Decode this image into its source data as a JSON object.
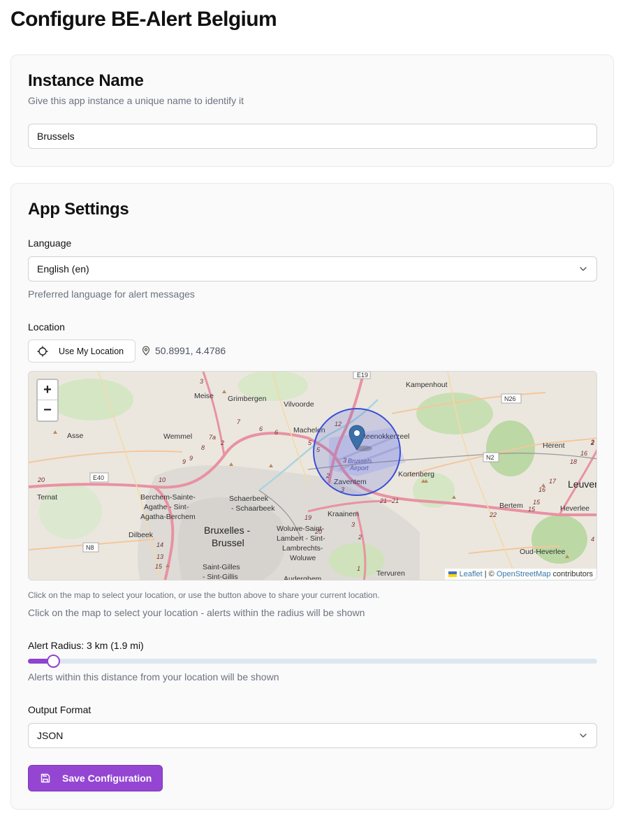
{
  "page": {
    "title": "Configure BE-Alert Belgium"
  },
  "instance": {
    "title": "Instance Name",
    "description": "Give this app instance a unique name to identify it",
    "value": "Brussels"
  },
  "settings": {
    "title": "App Settings",
    "language": {
      "label": "Language",
      "selected": "English (en)",
      "help": "Preferred language for alert messages"
    },
    "location": {
      "label": "Location",
      "use_my_location": "Use My Location",
      "coordinates": "50.8991, 4.4786",
      "help_small": "Click on the map to select your location, or use the button above to share your current location.",
      "help": "Click on the map to select your location - alerts within the radius will be shown"
    },
    "map": {
      "zoom_in": "+",
      "zoom_out": "−",
      "attribution": {
        "leaflet": "Leaflet",
        "sep": " | © ",
        "osm": "OpenStreetMap",
        "contributors": " contributors"
      },
      "places": {
        "kampenhout": "Kampenhout",
        "meise": "Meise",
        "grimbergen": "Grimbergen",
        "vilvoorde": "Vilvoorde",
        "asse": "Asse",
        "wemmel": "Wemmel",
        "machelen": "Machelen",
        "steenokkerzeel": "Steenokkerzeel",
        "herent": "Herent",
        "brussels_airport_1": "Brussels",
        "brussels_airport_2": "Airport",
        "leuven": "Leuven",
        "kortenberg": "Kortenberg",
        "zaventem": "Zaventem",
        "ternat": "Ternat",
        "berchem_1": "Berchem-Sainte-",
        "berchem_2": "Agathe - Sint-",
        "berchem_3": "Agatha-Berchem",
        "schaerbeek_1": "Schaerbeek",
        "schaerbeek_2": "- Schaarbeek",
        "kraainem": "Kraainem",
        "bertem": "Bertem",
        "heverlee": "Heverlee",
        "dilbeek": "Dilbeek",
        "bruxelles_1": "Bruxelles -",
        "bruxelles_2": "Brussel",
        "woluwe_1": "Woluwe-Saint-",
        "woluwe_2": "Lambert - Sint-",
        "woluwe_3": "Lambrechts-",
        "woluwe_4": "Woluwe",
        "oud_heverlee": "Oud-Heverlee",
        "stgilles_1": "Saint-Gilles",
        "stgilles_2": "- Sint-Gillis",
        "auderghem": "Auderghem",
        "tervuren": "Tervuren"
      },
      "roads": {
        "e19": "E19",
        "n26": "N26",
        "n2": "N2",
        "e40": "E40",
        "n8": "N8"
      },
      "road_numbers": [
        "3",
        "7",
        "6",
        "6",
        "7a",
        "2",
        "8",
        "9",
        "9",
        "5",
        "12",
        "5",
        "3",
        "2",
        "3",
        "20",
        "10",
        "20",
        "19",
        "21",
        "21",
        "22",
        "15",
        "15",
        "16",
        "17",
        "18",
        "16",
        "2",
        "4",
        "2",
        "14",
        "13",
        "15",
        "3",
        "1",
        "2"
      ]
    },
    "radius": {
      "label": "Alert Radius: 3 km (1.9 mi)",
      "value_km": 3,
      "fraction": 0.032,
      "help": "Alerts within this distance from your location will be shown"
    },
    "output": {
      "label": "Output Format",
      "selected": "JSON"
    },
    "save_label": "Save Configuration"
  },
  "colors": {
    "accent": "#9446d3",
    "radius_circle": "#3b4fd8",
    "marker": "#3b6fa8"
  }
}
